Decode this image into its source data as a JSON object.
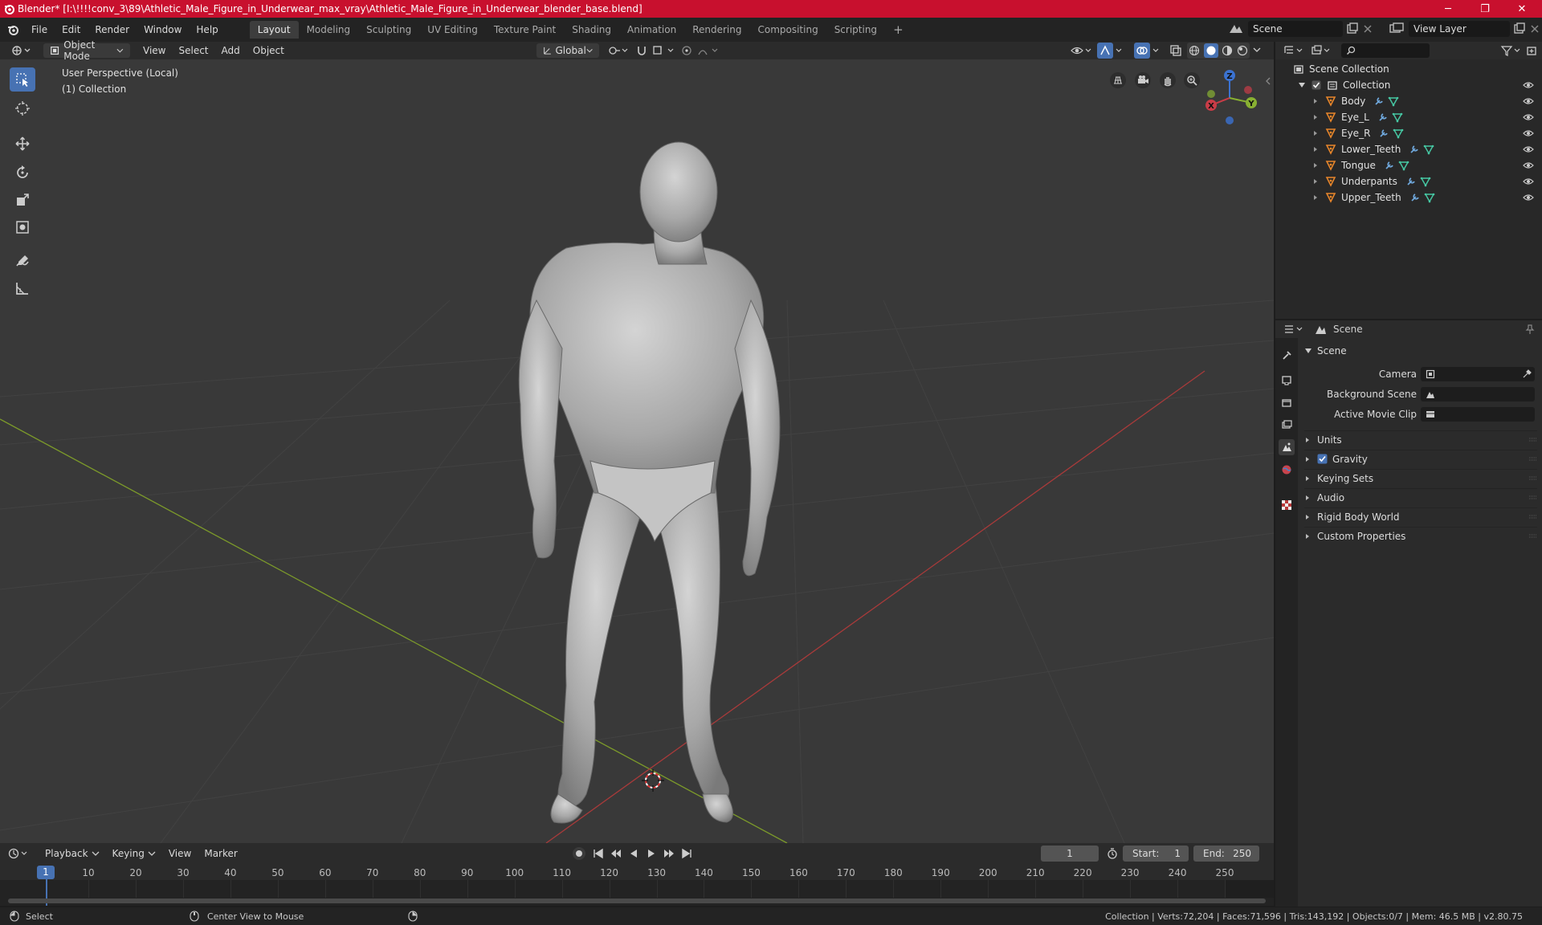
{
  "window": {
    "title": "Blender* [I:\\!!!!conv_3\\89\\Athletic_Male_Figure_in_Underwear_max_vray\\Athletic_Male_Figure_in_Underwear_blender_base.blend]",
    "minimize": "─",
    "maximize": "❐",
    "close": "✕"
  },
  "menu": [
    "File",
    "Edit",
    "Render",
    "Window",
    "Help"
  ],
  "workspaces": [
    "Layout",
    "Modeling",
    "Sculpting",
    "UV Editing",
    "Texture Paint",
    "Shading",
    "Animation",
    "Rendering",
    "Compositing",
    "Scripting"
  ],
  "workspace_add": "+",
  "scene_field": "Scene",
  "viewlayer_field": "View Layer",
  "viewport_header": {
    "mode": "Object Mode",
    "menus": [
      "View",
      "Select",
      "Add",
      "Object"
    ],
    "transform_orientation": "Global"
  },
  "viewport": {
    "perspective_label": "User Perspective (Local)",
    "collection_label": "(1) Collection",
    "gizmo": {
      "x": "X",
      "y": "Y",
      "z": "Z"
    }
  },
  "outliner": {
    "root": "Scene Collection",
    "collection": "Collection",
    "objects": [
      "Body",
      "Eye_L",
      "Eye_R",
      "Lower_Teeth",
      "Tongue",
      "Underpants",
      "Upper_Teeth"
    ]
  },
  "properties": {
    "header": "Scene",
    "panel_title": "Scene",
    "fields": [
      {
        "label": "Camera"
      },
      {
        "label": "Background Scene"
      },
      {
        "label": "Active Movie Clip"
      }
    ],
    "subpanels": [
      "Units",
      "Gravity",
      "Keying Sets",
      "Audio",
      "Rigid Body World",
      "Custom Properties"
    ],
    "gravity_checked": true
  },
  "timeline_header": {
    "menus": [
      "Playback",
      "Keying",
      "View",
      "Marker"
    ],
    "current_frame": "1",
    "start_label": "Start:",
    "start_value": "1",
    "end_label": "End:",
    "end_value": "250"
  },
  "timeline": {
    "current_frame_marker": "1",
    "ticks": [
      "10",
      "20",
      "30",
      "40",
      "50",
      "60",
      "70",
      "80",
      "90",
      "100",
      "110",
      "120",
      "130",
      "140",
      "150",
      "160",
      "170",
      "180",
      "190",
      "200",
      "210",
      "220",
      "230",
      "240",
      "250"
    ]
  },
  "statusbar": {
    "select": "Select",
    "center_view": "Center View to Mouse",
    "stats": "Collection | Verts:72,204 | Faces:71,596 | Tris:143,192 | Objects:0/7 | Mem: 46.5 MB | v2.80.75"
  }
}
